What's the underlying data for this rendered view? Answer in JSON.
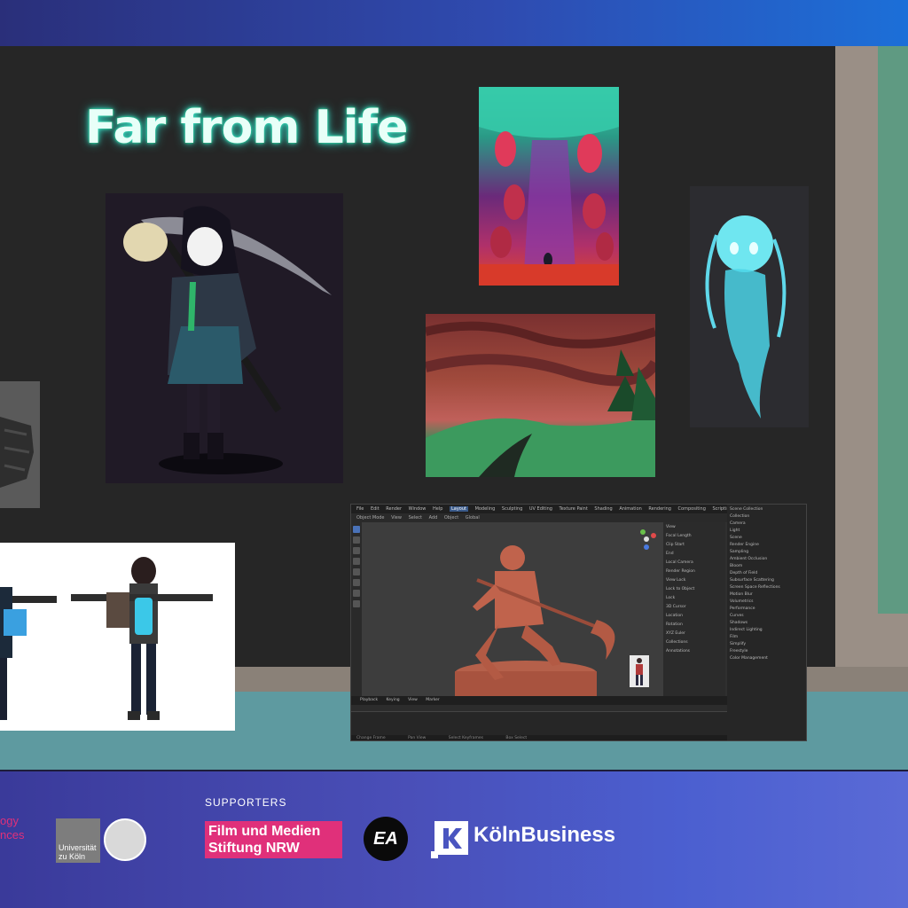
{
  "presentation": {
    "title": "Far from Life"
  },
  "blender": {
    "menu": [
      "File",
      "Edit",
      "Render",
      "Window",
      "Help"
    ],
    "workspace_tabs": [
      "Layout",
      "Modeling",
      "Sculpting",
      "UV Editing",
      "Texture Paint",
      "Shading",
      "Animation",
      "Rendering",
      "Compositing",
      "Scripting"
    ],
    "active_tab": "Layout",
    "toolbar": [
      "Object Mode",
      "View",
      "Select",
      "Add",
      "Object",
      "Global"
    ],
    "npanel": [
      "View",
      "Focal Length",
      "Clip Start",
      "End",
      "Local Camera",
      "Render Region",
      "View Lock",
      "Lock to Object",
      "Lock",
      "3D Cursor",
      "Location",
      "Rotation",
      "XYZ Euler",
      "Collections",
      "Annotations"
    ],
    "outliner": [
      "Scene Collection",
      "Collection",
      "Camera",
      "Light",
      "Scene",
      "Render Engine",
      "Sampling",
      "Ambient Occlusion",
      "Bloom",
      "Depth of Field",
      "Subsurface Scattering",
      "Screen Space Reflections",
      "Motion Blur",
      "Volumetrics",
      "Performance",
      "Curves",
      "Shadows",
      "Indirect Lighting",
      "Film",
      "Simplify",
      "Freestyle",
      "Color Management"
    ],
    "timeline_head": [
      "Playback",
      "Keying",
      "View",
      "Marker"
    ],
    "status": [
      "Change Frame",
      "Pan View",
      "Select Keyframes",
      "Box Select"
    ]
  },
  "footer": {
    "partial_label_line1": "ogy",
    "partial_label_line2": "nces",
    "university_name": "Universität zu Köln",
    "supporters_heading": "SUPPORTERS",
    "film_logo_line1": "Film und Medien",
    "film_logo_line2": "Stiftung NRW",
    "ea_logo": "EA",
    "koeln_logo": "KölnBusiness"
  },
  "colors": {
    "title_glow": "#3de0c8",
    "footer_accent": "#e0307a",
    "floor": "#5e9aa0",
    "wall_green": "#5f9a82"
  }
}
